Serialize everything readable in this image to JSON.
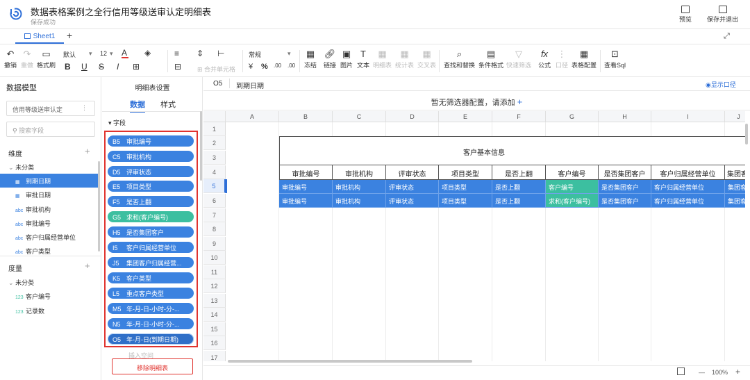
{
  "header": {
    "title": "数据表格案例之全行信用等级送审认定明细表",
    "status": "保存成功",
    "preview_label": "预览",
    "save_exit_label": "保存并退出"
  },
  "sheets": {
    "tabs": [
      "Sheet1"
    ],
    "add": "+"
  },
  "toolbar": {
    "undo": "撤销",
    "redo": "重做",
    "format_painter": "格式刷",
    "font": "默认",
    "font_size": "12",
    "merge": "合并单元格",
    "number_format": "常规",
    "currency": "¥",
    "percent": "%",
    "dec_inc": ".00",
    "dec_dec": ".00",
    "freeze": "冻结",
    "link": "链接",
    "image": "图片",
    "text": "文本",
    "detail_table": "明细表",
    "stats_table": "统计表",
    "cross_table": "交叉表",
    "find_replace": "查找和替换",
    "cond_format": "条件格式",
    "quick_filter": "快速筛选",
    "formula": "公式",
    "caliber": "口径",
    "table_config": "表格配置",
    "view_sql": "查看Sql",
    "icons": [
      "undo-icon",
      "redo-icon",
      "format-painter-icon",
      "bold-icon",
      "underline-icon",
      "strike-icon",
      "italic-icon",
      "border-icon"
    ]
  },
  "left_panel": {
    "title": "数据模型",
    "model_select": "信用等级送审认定",
    "search_placeholder": "搜索字段",
    "dimension_label": "维度",
    "measure_label": "度量",
    "dim_category": "未分类",
    "measure_category": "未分类",
    "dimensions": [
      {
        "type": "date",
        "label": "到期日期",
        "selected": true
      },
      {
        "type": "date",
        "label": "审批日期",
        "selected": false
      },
      {
        "type": "abc",
        "label": "审批机构",
        "selected": false
      },
      {
        "type": "abc",
        "label": "审批编号",
        "selected": false
      },
      {
        "type": "abc",
        "label": "客户归属经营单位",
        "selected": false
      },
      {
        "type": "abc",
        "label": "客户类型",
        "selected": false
      }
    ],
    "measures": [
      {
        "type": "123",
        "label": "客户编号"
      },
      {
        "type": "123",
        "label": "记录数"
      }
    ]
  },
  "mid_panel": {
    "title": "明细表设置",
    "tab_data": "数据",
    "tab_style": "样式",
    "fields_label": "字段",
    "fields": [
      {
        "cell": "B5",
        "label": "审批编号",
        "style": "normal"
      },
      {
        "cell": "C5",
        "label": "审批机构",
        "style": "normal"
      },
      {
        "cell": "D5",
        "label": "评审状态",
        "style": "normal"
      },
      {
        "cell": "E5",
        "label": "项目类型",
        "style": "normal"
      },
      {
        "cell": "F5",
        "label": "是否上翻",
        "style": "normal"
      },
      {
        "cell": "G5",
        "label": "求和(客户编号)",
        "style": "green"
      },
      {
        "cell": "H5",
        "label": "是否集团客户",
        "style": "normal"
      },
      {
        "cell": "I5",
        "label": "客户归属经营单位",
        "style": "normal"
      },
      {
        "cell": "J5",
        "label": "集团客户归属经营...",
        "style": "normal"
      },
      {
        "cell": "K5",
        "label": "客户类型",
        "style": "normal"
      },
      {
        "cell": "L5",
        "label": "重点客户类型",
        "style": "normal"
      },
      {
        "cell": "M5",
        "label": "年-月-日-小时-分-...",
        "style": "normal"
      },
      {
        "cell": "N5",
        "label": "年-月-日-小时-分-...",
        "style": "normal"
      },
      {
        "cell": "O5",
        "label": "年-月-日(到期日期)",
        "style": "dark"
      }
    ],
    "faded_text": "插入空间",
    "remove_button": "移除明细表"
  },
  "formula_bar": {
    "cell_ref": "O5",
    "value": "到期日期",
    "show_caliber": "显示口径"
  },
  "filter_bar": {
    "text": "暂无筛选器配置，请添加",
    "add": "+"
  },
  "grid": {
    "columns": [
      "A",
      "B",
      "C",
      "D",
      "E",
      "F",
      "G",
      "H",
      "I",
      "J"
    ],
    "rows": [
      "1",
      "2",
      "3",
      "4",
      "5",
      "6",
      "7",
      "8",
      "9",
      "10",
      "11",
      "12",
      "13",
      "14",
      "15",
      "16",
      "17"
    ],
    "merged_title": "客户基本信息",
    "headers": [
      "审批编号",
      "审批机构",
      "评审状态",
      "项目类型",
      "是否上翻",
      "客户编号",
      "是否集团客户",
      "客户归属经营单位",
      "集团客"
    ],
    "row5": [
      "审批编号",
      "审批机构",
      "评审状态",
      "项目类型",
      "是否上翻",
      "客户编号",
      "是否集团客户",
      "客户归属经营单位",
      "集团客户"
    ],
    "row6": [
      "审批编号",
      "审批机构",
      "评审状态",
      "项目类型",
      "是否上翻",
      "求和(客户编号)",
      "是否集团客户",
      "客户归属经营单位",
      "集团客户"
    ]
  },
  "statusbar": {
    "zoom": "100%",
    "minus": "—",
    "plus": "+"
  }
}
